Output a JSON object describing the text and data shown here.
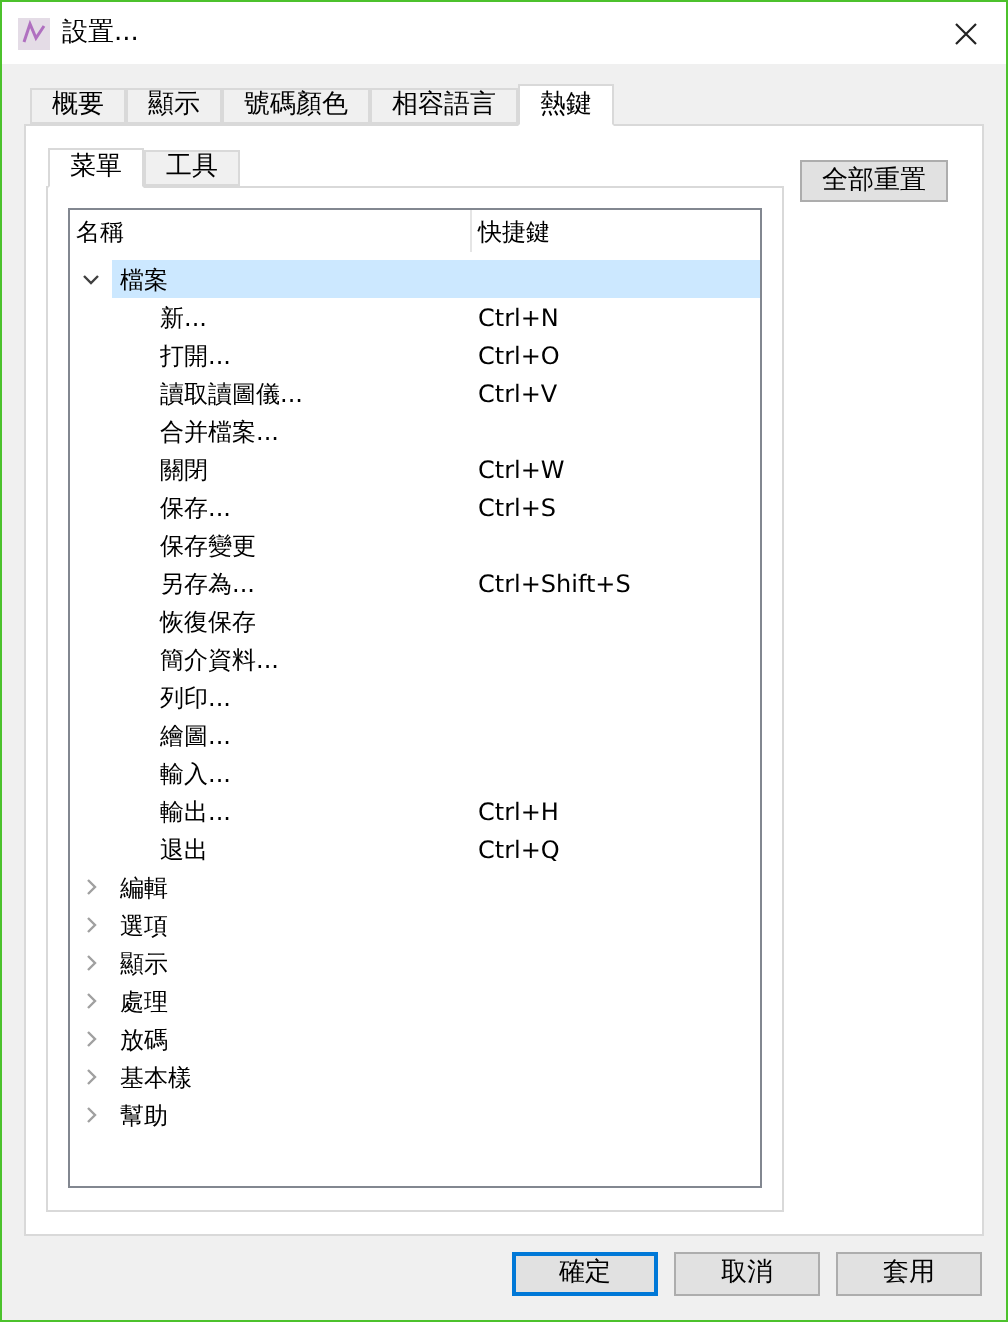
{
  "window": {
    "title": "設置..."
  },
  "tabs": [
    {
      "label": "概要",
      "selected": false
    },
    {
      "label": "顯示",
      "selected": false
    },
    {
      "label": "號碼顏色",
      "selected": false
    },
    {
      "label": "相容語言",
      "selected": false
    },
    {
      "label": "熱鍵",
      "selected": true
    }
  ],
  "subtabs": [
    {
      "label": "菜單",
      "selected": true
    },
    {
      "label": "工具",
      "selected": false
    }
  ],
  "reset_button": "全部重置",
  "tree": {
    "columns": [
      "名稱",
      "快捷鍵"
    ],
    "items": [
      {
        "label": "檔案",
        "expanded": true,
        "selected": true,
        "children": [
          {
            "label": "新...",
            "shortcut": "Ctrl+N",
            "selected": false
          },
          {
            "label": "打開...",
            "shortcut": "Ctrl+O",
            "selected": false
          },
          {
            "label": "讀取讀圖儀...",
            "shortcut": "Ctrl+V",
            "selected": false
          },
          {
            "label": "合并檔案...",
            "selected": false
          },
          {
            "label": "關閉",
            "shortcut": "Ctrl+W",
            "selected": false
          },
          {
            "label": "保存...",
            "shortcut": "Ctrl+S",
            "selected": false
          },
          {
            "label": "保存變更",
            "selected": false
          },
          {
            "label": "另存為...",
            "shortcut": "Ctrl+Shift+S",
            "selected": false
          },
          {
            "label": "恢復保存",
            "selected": false
          },
          {
            "label": "簡介資料...",
            "selected": false
          },
          {
            "label": "列印...",
            "selected": false
          },
          {
            "label": "繪圖...",
            "selected": false
          },
          {
            "label": "輸入...",
            "selected": false
          },
          {
            "label": "輸出...",
            "shortcut": "Ctrl+H",
            "selected": false
          },
          {
            "label": "退出",
            "shortcut": "Ctrl+Q",
            "selected": false
          }
        ]
      },
      {
        "label": "編輯",
        "expanded": false,
        "selected": false
      },
      {
        "label": "選項",
        "expanded": false,
        "selected": false
      },
      {
        "label": "顯示",
        "expanded": false,
        "selected": false
      },
      {
        "label": "處理",
        "expanded": false,
        "selected": false
      },
      {
        "label": "放碼",
        "expanded": false,
        "selected": false
      },
      {
        "label": "基本樣",
        "expanded": false,
        "selected": false
      },
      {
        "label": "幫助",
        "expanded": false,
        "selected": false
      }
    ]
  },
  "buttons": [
    {
      "label": "確定",
      "focused": true
    },
    {
      "label": "取消",
      "focused": false
    },
    {
      "label": "套用",
      "focused": false
    }
  ]
}
